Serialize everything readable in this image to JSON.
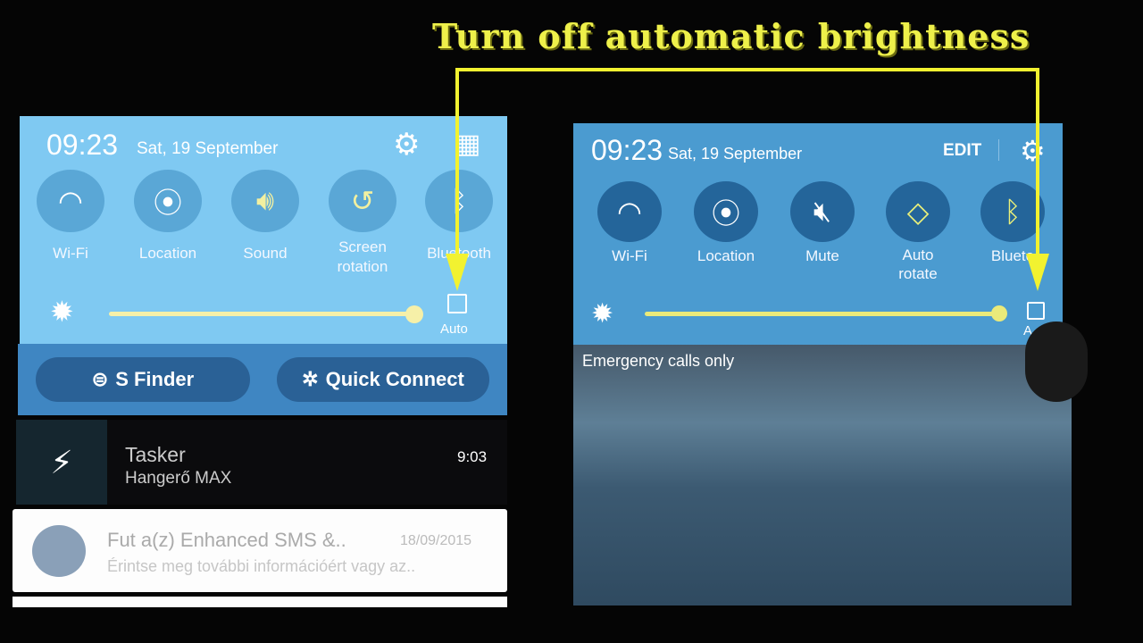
{
  "annotation": {
    "title": "Turn off automatic brightness",
    "color": "#f2f230"
  },
  "left_phone": {
    "time": "09:23",
    "date": "Sat, 19 September",
    "header_icons": [
      "gear-icon",
      "grid-icon"
    ],
    "toggles": [
      {
        "label": "Wi-Fi",
        "icon": "wifi-icon"
      },
      {
        "label": "Location",
        "icon": "location-icon"
      },
      {
        "label": "Sound",
        "icon": "sound-icon"
      },
      {
        "label": "Screen rotation",
        "icon": "screen-rotation-icon"
      },
      {
        "label": "Bluetooth",
        "icon": "bluetooth-icon"
      }
    ],
    "brightness": {
      "level": 0.98,
      "auto_label": "Auto",
      "auto_checked": false
    },
    "buttons": {
      "s_finder": "S Finder",
      "quick_connect": "Quick Connect"
    },
    "notifications": [
      {
        "app": "Tasker",
        "text": "Hangerő MAX",
        "time": "9:03"
      },
      {
        "title": "Fut a(z) Enhanced SMS &..",
        "date": "18/09/2015",
        "text": "Érintse meg további információért vagy az.."
      }
    ],
    "accent": "#7fc9f2"
  },
  "right_phone": {
    "time": "09:23",
    "date": "Sat, 19 September",
    "edit": "EDIT",
    "toggles": [
      {
        "label": "Wi-Fi",
        "icon": "wifi-icon"
      },
      {
        "label": "Location",
        "icon": "location-icon"
      },
      {
        "label": "Mute",
        "icon": "mute-icon"
      },
      {
        "label": "Auto rotate",
        "icon": "auto-rotate-icon"
      },
      {
        "label": "Blueto",
        "icon": "bluetooth-icon"
      }
    ],
    "brightness": {
      "level": 0.98,
      "auto_label": "A",
      "auto_checked": false
    },
    "status": "Emergency calls only",
    "accent": "#4b9bd0"
  }
}
